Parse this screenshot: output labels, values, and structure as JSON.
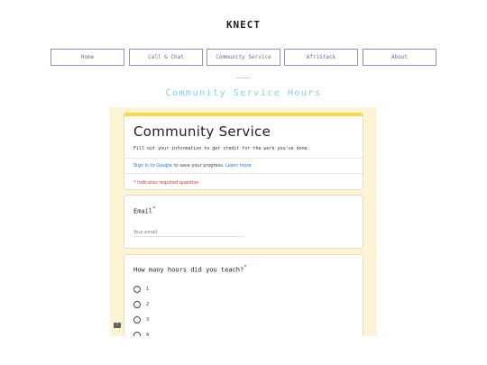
{
  "site": {
    "title": "KNECT"
  },
  "nav": {
    "items": [
      {
        "label": "Home"
      },
      {
        "label": "Call & Chat"
      },
      {
        "label": "Community Service"
      },
      {
        "label": "AfriStack"
      },
      {
        "label": "About"
      }
    ]
  },
  "page": {
    "heading": "Community Service Hours"
  },
  "form": {
    "title": "Community Service",
    "description": "Fill out your information to get credit for the work you've done.",
    "signin_link": "Sign in to Google",
    "signin_text": "to save your progress.",
    "learn_more": "Learn more",
    "required_note": "* Indicates required question",
    "email": {
      "label": "Email",
      "placeholder": "Your email"
    },
    "hours": {
      "label": "How many hours did you teach?",
      "options": [
        "1",
        "2",
        "3",
        "4"
      ]
    },
    "required_mark": "*",
    "report_icon": "!"
  },
  "colors": {
    "accent": "#7fd3de",
    "form_band": "#f7d94c",
    "form_background": "#fdf4d5",
    "nav_border": "#8f92c0",
    "required": "#d93025",
    "link": "#1a73e8"
  }
}
